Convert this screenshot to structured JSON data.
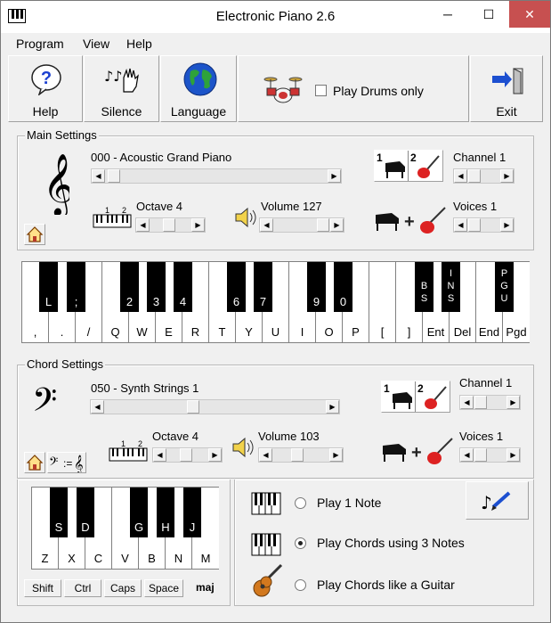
{
  "window": {
    "title": "Electronic Piano 2.6",
    "controls": {
      "minimize": "─",
      "maximize": "☐",
      "close": "✕"
    }
  },
  "menu": [
    "Program",
    "View",
    "Help"
  ],
  "toolbar": {
    "help": "Help",
    "silence": "Silence",
    "language": "Language",
    "drums_label": "Play Drums only",
    "drums_checked": false,
    "exit": "Exit"
  },
  "main": {
    "group_title": "Main Settings",
    "instrument": "000 - Acoustic Grand Piano",
    "octave_label": "Octave 4",
    "volume_label": "Volume 127",
    "channel_label": "Channel 1",
    "voices_label": "Voices 1",
    "voice_buttons": [
      "1",
      "2"
    ],
    "octave_numbers": [
      "1",
      "2"
    ]
  },
  "keyboard": {
    "white_keys": [
      ",",
      ".",
      "/",
      "Q",
      "W",
      "E",
      "R",
      "T",
      "Y",
      "U",
      "I",
      "O",
      "P",
      "[",
      "]",
      "Ent",
      "Del",
      "End",
      "Pgd"
    ],
    "black_keys": [
      "L",
      ";",
      "2",
      "3",
      "4",
      "6",
      "7",
      "9",
      "0",
      "BS",
      "INS",
      "PGU"
    ]
  },
  "chord": {
    "group_title": "Chord Settings",
    "instrument": "050 - Synth Strings 1",
    "octave_label": "Octave 4",
    "volume_label": "Volume 103",
    "channel_label": "Channel 1",
    "voices_label": "Voices 1",
    "voice_buttons": [
      "1",
      "2"
    ],
    "octave_numbers": [
      "1",
      "2"
    ],
    "mini_white_keys": [
      "Z",
      "X",
      "C",
      "V",
      "B",
      "N",
      "M"
    ],
    "mini_black_keys": [
      "S",
      "D",
      "G",
      "H",
      "J"
    ],
    "modifier_buttons": [
      "Shift",
      "Ctrl",
      "Caps",
      "Space"
    ],
    "chord_type": "maj",
    "options": [
      "Play 1 Note",
      "Play Chords using 3 Notes",
      "Play Chords like a Guitar"
    ],
    "selected_option": "Play Chords using 3 Notes"
  }
}
